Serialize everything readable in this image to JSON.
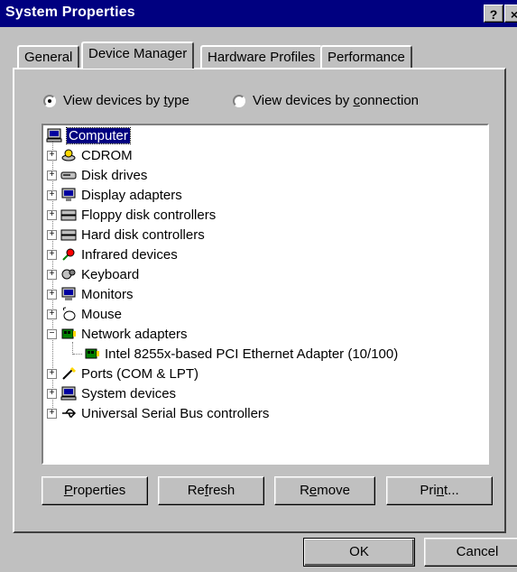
{
  "window": {
    "title": "System Properties",
    "help_glyph": "?",
    "close_glyph": "×"
  },
  "tabs": [
    {
      "label": "General",
      "selected": false
    },
    {
      "label": "Device Manager",
      "selected": true
    },
    {
      "label": "Hardware Profiles",
      "selected": false
    },
    {
      "label": "Performance",
      "selected": false
    }
  ],
  "view_mode": {
    "by_type": {
      "label_pre": "View devices by ",
      "key": "t",
      "label_post": "ype",
      "checked": true
    },
    "by_connection": {
      "label_pre": "View devices by ",
      "key": "c",
      "label_post": "onnection",
      "checked": false
    }
  },
  "tree": {
    "root": {
      "label": "Computer",
      "icon": "computer-icon"
    },
    "items": [
      {
        "label": "CDROM",
        "icon": "cdrom-icon",
        "expander": "+"
      },
      {
        "label": "Disk drives",
        "icon": "disk-drive-icon",
        "expander": "+"
      },
      {
        "label": "Display adapters",
        "icon": "display-icon",
        "expander": "+"
      },
      {
        "label": "Floppy disk controllers",
        "icon": "floppy-controller-icon",
        "expander": "+"
      },
      {
        "label": "Hard disk controllers",
        "icon": "hdd-controller-icon",
        "expander": "+"
      },
      {
        "label": "Infrared devices",
        "icon": "infrared-icon",
        "expander": "+"
      },
      {
        "label": "Keyboard",
        "icon": "keyboard-icon",
        "expander": "+"
      },
      {
        "label": "Monitors",
        "icon": "monitor-icon",
        "expander": "+"
      },
      {
        "label": "Mouse",
        "icon": "mouse-icon",
        "expander": "+"
      },
      {
        "label": "Network adapters",
        "icon": "network-card-icon",
        "expander": "−"
      },
      {
        "label": "Intel 8255x-based PCI Ethernet Adapter (10/100)",
        "icon": "network-card-icon",
        "expander": ""
      },
      {
        "label": "Ports (COM & LPT)",
        "icon": "port-icon",
        "expander": "+"
      },
      {
        "label": "System devices",
        "icon": "system-device-icon",
        "expander": "+"
      },
      {
        "label": "Universal Serial Bus controllers",
        "icon": "usb-icon",
        "expander": "+"
      }
    ]
  },
  "buttons": {
    "properties": {
      "pre": "",
      "key": "P",
      "post": "roperties"
    },
    "refresh": {
      "pre": "Re",
      "key": "f",
      "post": "resh"
    },
    "remove": {
      "pre": "R",
      "key": "e",
      "post": "move"
    },
    "print": {
      "pre": "Pri",
      "key": "n",
      "post": "t..."
    },
    "ok": "OK",
    "cancel": "Cancel"
  },
  "colors": {
    "titlebar": "#000080",
    "face": "#c0c0c0",
    "selection": "#000080"
  }
}
